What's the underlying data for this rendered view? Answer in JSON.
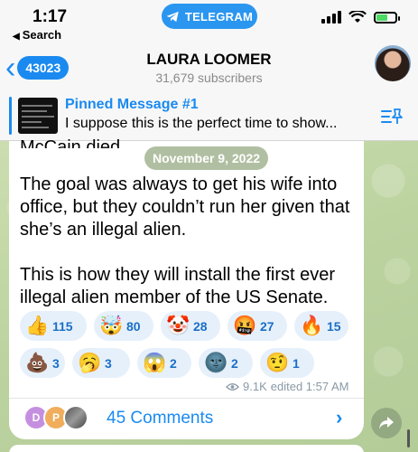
{
  "status_bar": {
    "time": "1:17",
    "back_app": "Search",
    "app_pill": "TELEGRAM"
  },
  "header": {
    "back_count": "43023",
    "title": "LAURA LOOMER",
    "subtitle": "31,679 subscribers"
  },
  "pinned": {
    "title": "Pinned Message #1",
    "text": "I suppose this is the perfect time to show..."
  },
  "message": {
    "cut_text": "McCain died.",
    "date": "November 9, 2022",
    "paragraphs": [
      "The goal was always to get his wife into office, but they couldn’t run her given that she’s an illegal alien.",
      "This is how they will install the first ever illegal alien member of the US Senate."
    ],
    "reactions": [
      {
        "emoji": "👍",
        "count": "115"
      },
      {
        "emoji": "🤯",
        "count": "80"
      },
      {
        "emoji": "🤡",
        "count": "28"
      },
      {
        "emoji": "🤬",
        "count": "27"
      },
      {
        "emoji": "🔥",
        "count": "15"
      },
      {
        "emoji": "💩",
        "count": "3"
      },
      {
        "emoji": "🥱",
        "count": "3"
      },
      {
        "emoji": "😱",
        "count": "2"
      },
      {
        "emoji": "🌚",
        "count": "2"
      },
      {
        "emoji": "🤨",
        "count": "1"
      }
    ],
    "views": "9.1K",
    "edited": "edited 1:57 AM"
  },
  "comments": {
    "avatars": [
      "D",
      "P",
      ""
    ],
    "label": "45 Comments"
  },
  "colors": {
    "accent": "#1a8af0",
    "telegram_pill": "#2b96f0",
    "reaction_bg": "#e6f0fb"
  }
}
